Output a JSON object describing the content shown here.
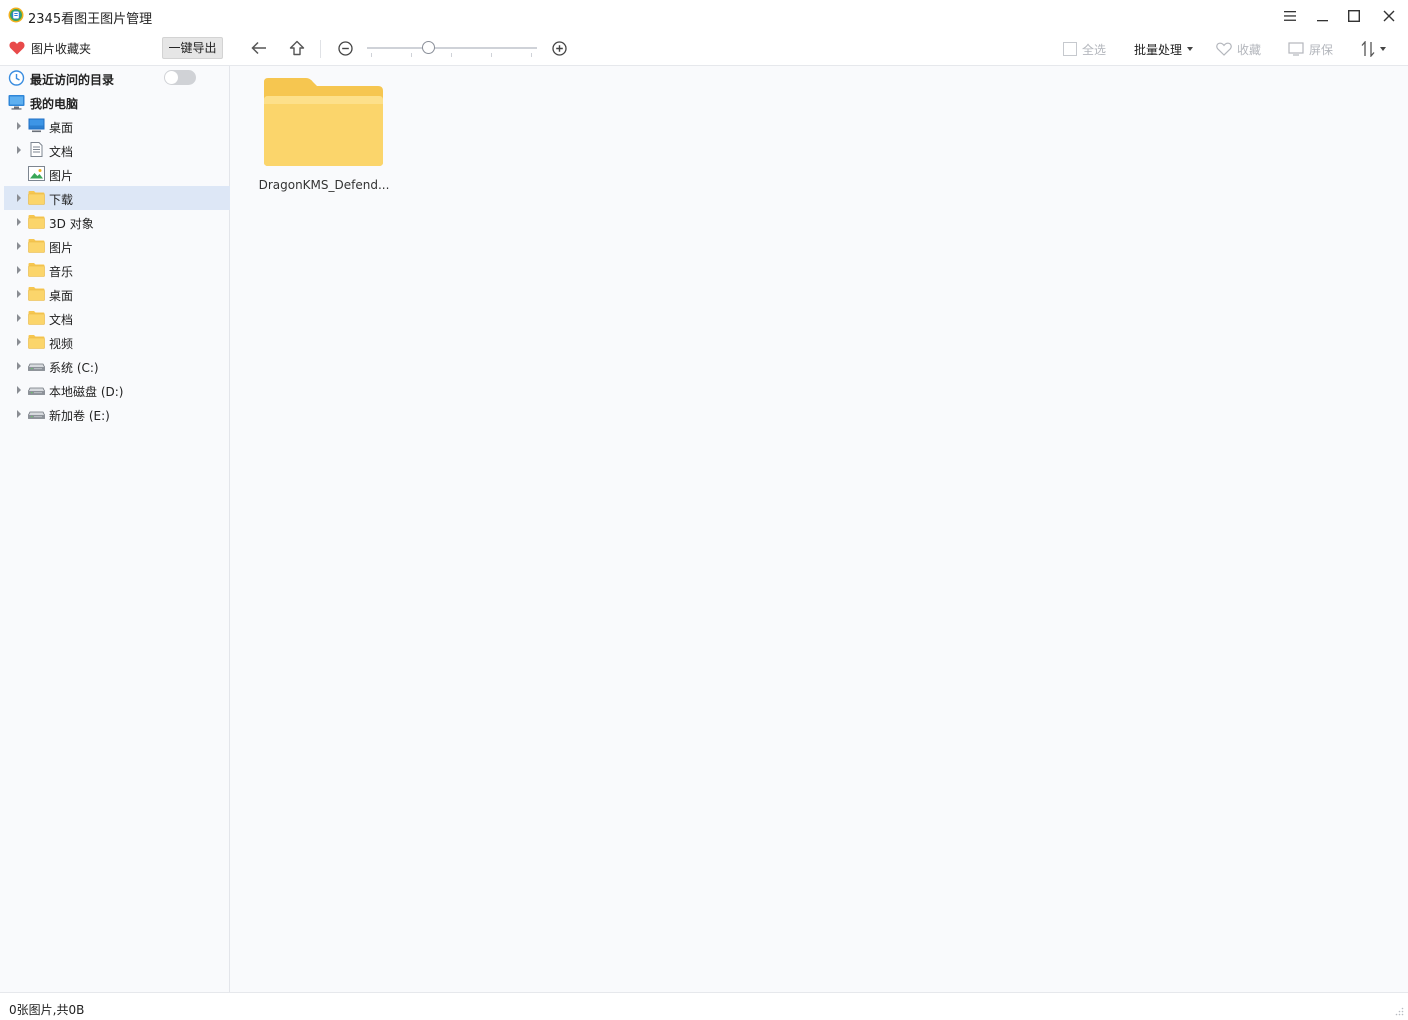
{
  "window": {
    "title": "2345看图王图片管理",
    "controls": [
      "menu-icon",
      "minimize-icon",
      "maximize-icon",
      "close-icon"
    ]
  },
  "toolbar": {
    "favorites_label": "图片收藏夹",
    "export_label": "一键导出",
    "zoom_level": 0.35,
    "select_all_label": "全选",
    "batch_label": "批量处理",
    "collect_label": "收藏",
    "screensaver_label": "屏保"
  },
  "sidebar": {
    "recent_label": "最近访问的目录",
    "recent_toggle_on": false,
    "computer_label": "我的电脑",
    "items": [
      {
        "label": "桌面",
        "icon": "desktop-icon",
        "expandable": true
      },
      {
        "label": "文档",
        "icon": "document-icon",
        "expandable": true
      },
      {
        "label": "图片",
        "icon": "picture-icon",
        "expandable": false
      },
      {
        "label": "下载",
        "icon": "folder-icon",
        "expandable": true,
        "selected": true
      },
      {
        "label": "3D 对象",
        "icon": "folder-icon",
        "expandable": true
      },
      {
        "label": "图片",
        "icon": "folder-icon",
        "expandable": true
      },
      {
        "label": "音乐",
        "icon": "folder-icon",
        "expandable": true
      },
      {
        "label": "桌面",
        "icon": "folder-icon",
        "expandable": true
      },
      {
        "label": "文档",
        "icon": "folder-icon",
        "expandable": true
      },
      {
        "label": "视频",
        "icon": "folder-icon",
        "expandable": true
      },
      {
        "label": "系统 (C:)",
        "icon": "drive-icon",
        "expandable": true
      },
      {
        "label": "本地磁盘 (D:)",
        "icon": "drive-icon",
        "expandable": true
      },
      {
        "label": "新加卷 (E:)",
        "icon": "drive-icon",
        "expandable": true
      }
    ]
  },
  "content": {
    "folders": [
      {
        "name": "DragonKMS_Defend..."
      }
    ]
  },
  "status": {
    "text": "0张图片,共0B"
  },
  "colors": {
    "accent": "#dde7f6",
    "folder": "#fbd56b",
    "heart": "#e84a4a"
  }
}
